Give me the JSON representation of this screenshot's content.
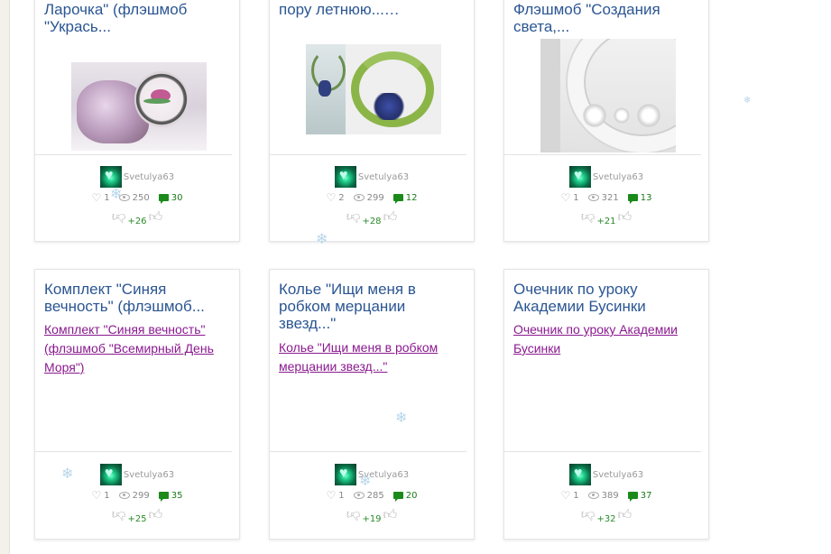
{
  "cards": [
    {
      "title": "Ларочка\" (флэшмоб \"Укрась...",
      "author": "Svetulya63",
      "likes": "1",
      "views": "250",
      "comments": "30",
      "rating": "+26"
    },
    {
      "title": "пору летнюю...…",
      "author": "Svetulya63",
      "likes": "2",
      "views": "299",
      "comments": "12",
      "rating": "+28"
    },
    {
      "title": "Флэшмоб \"Создания света,...",
      "author": "Svetulya63",
      "likes": "1",
      "views": "321",
      "comments": "13",
      "rating": "+21"
    },
    {
      "title": "Комплект \"Синяя вечность\" (флэшмоб...",
      "link": "Комплект \"Синяя вечность\" (флэшмоб \"Всемирный День Моря\")",
      "author": "Svetulya63",
      "likes": "1",
      "views": "299",
      "comments": "35",
      "rating": "+25"
    },
    {
      "title": "Колье \"Ищи меня в робком мерцании звезд...\"",
      "link": "Колье \"Ищи меня в робком мерцании звезд...\"",
      "author": "Svetulya63",
      "likes": "1",
      "views": "285",
      "comments": "20",
      "rating": "+19"
    },
    {
      "title": "Очечник по уроку Академии Бусинки",
      "link": "Очечник по уроку Академии Бусинки",
      "author": "Svetulya63",
      "likes": "1",
      "views": "389",
      "comments": "37",
      "rating": "+32"
    }
  ],
  "colors": {
    "title": "#2b5693",
    "link": "#8a1a8f",
    "comments": "#1a8a1a"
  }
}
